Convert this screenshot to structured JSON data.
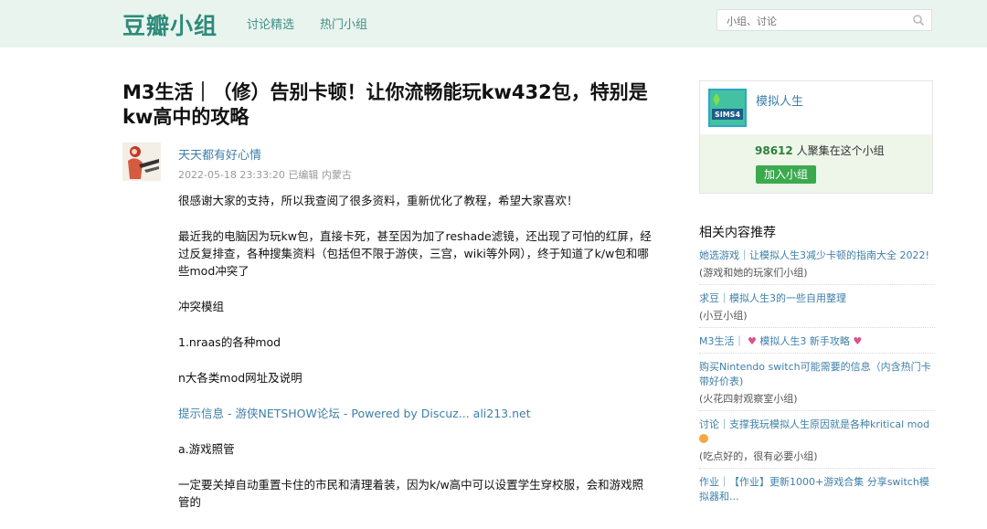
{
  "header": {
    "logo": "豆瓣小组",
    "nav": [
      "讨论精选",
      "热门小组"
    ],
    "search_placeholder": "小组、讨论"
  },
  "post": {
    "title": "M3生活｜（修）告别卡顿！让你流畅能玩kw432包，特别是kw高中的攻略",
    "author": "天天都有好心情",
    "meta": "2022-05-18 23:33:20 已编辑 内蒙古",
    "paragraphs": [
      "很感谢大家的支持，所以我查阅了很多资料，重新优化了教程，希望大家喜欢！",
      "最近我的电脑因为玩kw包，直接卡死，甚至因为加了reshade滤镜，还出现了可怕的红屏，经过反复排查，各种搜集资料（包括但不限于游侠，三宫，wiki等外网），终于知道了k/w包和哪些mod冲突了",
      "冲突模组",
      "1.nraas的各种mod",
      "n大各类mod网址及说明"
    ],
    "link_line": [
      "提示信息 -",
      "游侠NETSHOW论坛 -",
      "Powered by Discuz...",
      "ali213.net"
    ],
    "paragraphs_after": [
      "a.游戏照管",
      "一定要关掉自动重置卡住的市民和清理着装，因为k/w高中可以设置学生穿校服，会和游戏照管的"
    ]
  },
  "sidebar": {
    "group": {
      "name": "模拟人生",
      "icon_text": "SIMS4",
      "count": "98612",
      "count_suffix": "人聚集在这个小组",
      "join_label": "加入小组"
    },
    "related_title": "相关内容推荐",
    "related": [
      {
        "title": "她选游戏｜让模拟人生3减少卡顿的指南大全 2022!",
        "group": "(游戏和她的玩家们小组)"
      },
      {
        "title": "求豆｜模拟人生3的一些自用整理",
        "group": "(小豆小组)"
      },
      {
        "title_a": "M3生活｜",
        "title_b": "模拟人生3 新手攻略"
      },
      {
        "title": "购买Nintendo switch可能需要的信息（内含热门卡带好价表)",
        "group": "(火花四射观察室小组)"
      },
      {
        "title": "讨论｜支撑我玩模拟人生原因就是各种kritical mod",
        "group": "(吃点好的，很有必要小组)"
      },
      {
        "title": "作业｜【作业】更新1000+游戏合集 分享switch模拟器和..."
      }
    ]
  },
  "colors": {
    "nav_bg": "#e9f4ee",
    "logo": "#2e8b79",
    "link": "#3f7fa8",
    "join": "#3ba94e"
  }
}
